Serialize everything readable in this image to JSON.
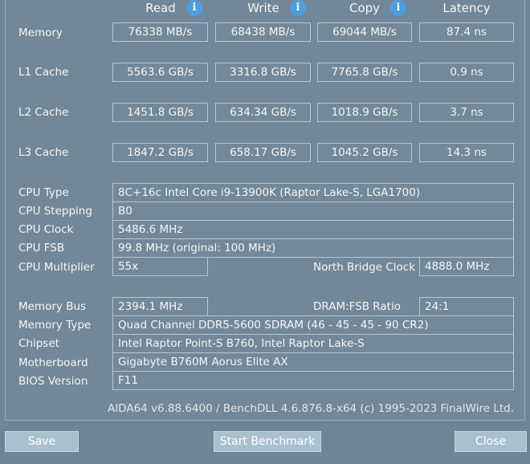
{
  "columns": {
    "read": "Read",
    "write": "Write",
    "copy": "Copy",
    "latency": "Latency"
  },
  "info_icon_glyph": "i",
  "bench": {
    "memory": {
      "label": "Memory",
      "read": "76338 MB/s",
      "write": "68438 MB/s",
      "copy": "69044 MB/s",
      "latency": "87.4 ns"
    },
    "l1": {
      "label": "L1 Cache",
      "read": "5563.6 GB/s",
      "write": "3316.8 GB/s",
      "copy": "7765.8 GB/s",
      "latency": "0.9 ns"
    },
    "l2": {
      "label": "L2 Cache",
      "read": "1451.8 GB/s",
      "write": "634.34 GB/s",
      "copy": "1018.9 GB/s",
      "latency": "3.7 ns"
    },
    "l3": {
      "label": "L3 Cache",
      "read": "1847.2 GB/s",
      "write": "658.17 GB/s",
      "copy": "1045.2 GB/s",
      "latency": "14.3 ns"
    }
  },
  "cpu": {
    "type_label": "CPU Type",
    "type": "8C+16c Intel Core i9-13900K  (Raptor Lake-S, LGA1700)",
    "stepping_label": "CPU Stepping",
    "stepping": "B0",
    "clock_label": "CPU Clock",
    "clock": "5486.6 MHz",
    "fsb_label": "CPU FSB",
    "fsb": "99.8 MHz  (original: 100 MHz)",
    "multiplier_label": "CPU Multiplier",
    "multiplier": "55x",
    "nb_clock_label": "North Bridge Clock",
    "nb_clock": "4888.0 MHz"
  },
  "mem": {
    "bus_label": "Memory Bus",
    "bus": "2394.1 MHz",
    "ratio_label": "DRAM:FSB Ratio",
    "ratio": "24:1",
    "type_label": "Memory Type",
    "type": "Quad Channel DDR5-5600 SDRAM  (46 - 45 - 45 - 90  CR2)",
    "chipset_label": "Chipset",
    "chipset": "Intel Raptor Point-S B760, Intel Raptor Lake-S",
    "mobo_label": "Motherboard",
    "mobo": "Gigabyte B760M Aorus Elite AX",
    "bios_label": "BIOS Version",
    "bios": "F11"
  },
  "footer": "AIDA64 v6.88.6400 / BenchDLL 4.6.876.8-x64  (c) 1995-2023 FinalWire Ltd.",
  "buttons": {
    "save": "Save",
    "start": "Start Benchmark",
    "close": "Close"
  },
  "colors": {
    "info_icon": "#4d9fe0",
    "button": "#a7c1d1",
    "panel": "#708899"
  }
}
